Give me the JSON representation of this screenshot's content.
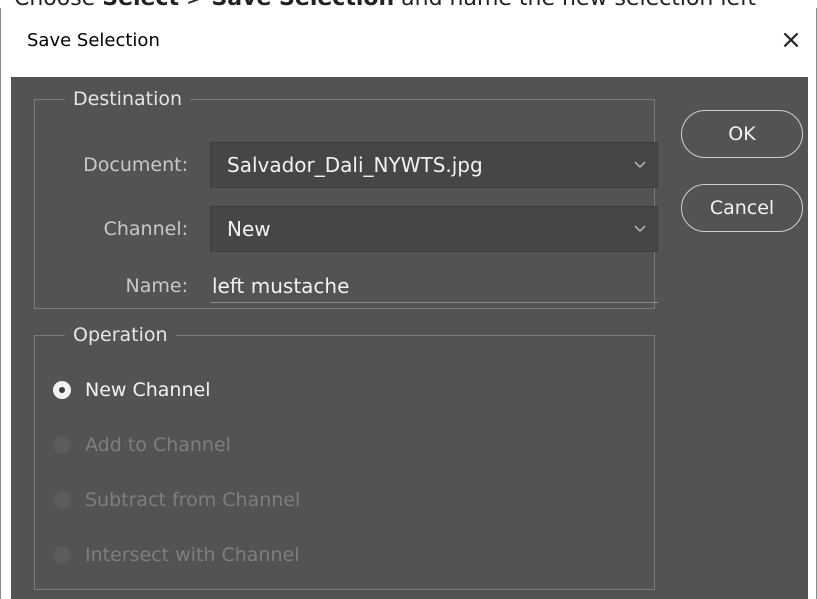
{
  "background_text": {
    "prefix": "Choose ",
    "select_word": "Select",
    "arrow": " > ",
    "menu_item": "Save Selection",
    "suffix": " and name the new selection left"
  },
  "dialog": {
    "title": "Save Selection",
    "close_symbol": "×"
  },
  "destination": {
    "legend": "Destination",
    "document_label": "Document:",
    "document_value": "Salvador_Dali_NYWTS.jpg",
    "channel_label": "Channel:",
    "channel_value": "New",
    "name_label": "Name:",
    "name_value": "left mustache"
  },
  "operation": {
    "legend": "Operation",
    "options": [
      {
        "label": "New Channel",
        "selected": true,
        "enabled": true
      },
      {
        "label": "Add to Channel",
        "selected": false,
        "enabled": false
      },
      {
        "label": "Subtract from Channel",
        "selected": false,
        "enabled": false
      },
      {
        "label": "Intersect with Channel",
        "selected": false,
        "enabled": false
      }
    ]
  },
  "buttons": {
    "ok": "OK",
    "cancel": "Cancel"
  },
  "colors": {
    "panel_bg": "#535353",
    "field_bg": "#464646",
    "text": "#f2f2f2",
    "label_text": "#c8c8c8",
    "disabled_text": "#7e7e7e"
  },
  "icons": {
    "close": "close-icon",
    "dropdown": "chevron-down-icon"
  }
}
